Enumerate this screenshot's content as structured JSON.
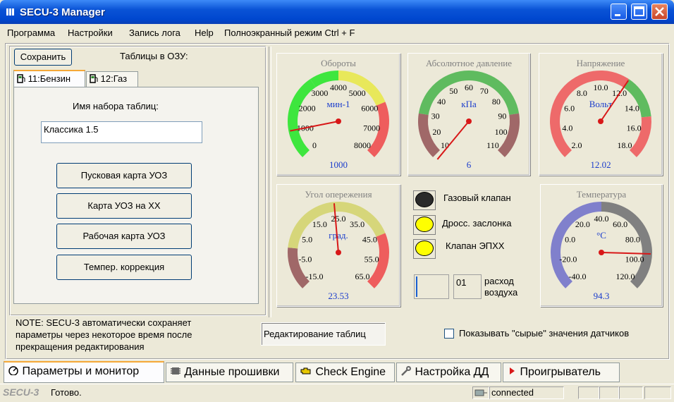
{
  "window": {
    "title": "SECU-3 Manager"
  },
  "menu": [
    "Программа",
    "Настройки",
    "Запись лога",
    "Help",
    "Полноэкранный режим Ctrl + F"
  ],
  "left_panel": {
    "save_label": "Сохранить",
    "tables_label": "Таблицы в ОЗУ:",
    "tabs": [
      "11:Бензин",
      "12:Газ"
    ],
    "set_name_label": "Имя набора таблиц:",
    "set_name_value": "Классика 1.5",
    "buttons": [
      "Пусковая карта УОЗ",
      "Карта УОЗ на ХХ",
      "Рабочая карта УОЗ",
      "Темпер. коррекция"
    ],
    "note": [
      "NOTE: SECU-3 автоматически сохраняет",
      "параметры через некоторое время после",
      "прекращения редактирования"
    ],
    "edit_tables_label": "Редактирование таблиц"
  },
  "gauges": {
    "rpm": {
      "title": "Обороты",
      "unit": "мин-1",
      "value": "1000",
      "min": 0,
      "max": 8000,
      "reading": 1000,
      "ticks": [
        "0",
        "1000",
        "2000",
        "3000",
        "4000",
        "5000",
        "6000",
        "7000",
        "8000"
      ],
      "bands": [
        {
          "from": 0,
          "to": 3000,
          "color": "#3ee63e"
        },
        {
          "from": 3000,
          "to": 4000,
          "color": "#3ee63e"
        },
        {
          "from": 4000,
          "to": 6000,
          "color": "#e8e85a"
        },
        {
          "from": 6000,
          "to": 8000,
          "color": "#ee5d5d"
        }
      ]
    },
    "map": {
      "title": "Абсолютное давление",
      "unit": "кПа",
      "value": "6",
      "min": 10,
      "max": 110,
      "reading": 6,
      "ticks": [
        "10",
        "20",
        "30",
        "40",
        "50",
        "60",
        "70",
        "80",
        "90",
        "100",
        "110"
      ],
      "bands": [
        {
          "from": 10,
          "to": 30,
          "color": "#a06868"
        },
        {
          "from": 30,
          "to": 90,
          "color": "#5fbb5f"
        },
        {
          "from": 90,
          "to": 110,
          "color": "#a06868"
        }
      ]
    },
    "voltage": {
      "title": "Напряжение",
      "unit": "Вольт",
      "value": "12.02",
      "min": 2.0,
      "max": 18.0,
      "reading": 12.02,
      "ticks": [
        "2.0",
        "4.0",
        "6.0",
        "8.0",
        "10.0",
        "12.0",
        "14.0",
        "16.0",
        "18.0"
      ],
      "bands": [
        {
          "from": 2.0,
          "to": 12.0,
          "color": "#ee6a6a"
        },
        {
          "from": 12.0,
          "to": 15.0,
          "color": "#5fbb5f"
        },
        {
          "from": 15.0,
          "to": 18.0,
          "color": "#ee6a6a"
        }
      ]
    },
    "advance": {
      "title": "Угол опережения",
      "unit": "град.",
      "value": "23.53",
      "min": -15.0,
      "max": 65.0,
      "reading": 23.53,
      "ticks": [
        "-15.0",
        "-5.0",
        "5.0",
        "15.0",
        "25.0",
        "35.0",
        "45.0",
        "55.0",
        "65.0"
      ],
      "bands": [
        {
          "from": -15,
          "to": 0,
          "color": "#a06868"
        },
        {
          "from": 0,
          "to": 45,
          "color": "#d6d67a"
        },
        {
          "from": 45,
          "to": 65,
          "color": "#ee5d5d"
        }
      ]
    },
    "temperature": {
      "title": "Температура",
      "unit": "°C",
      "value": "94.3",
      "min": -40.0,
      "max": 120.0,
      "reading": 94.3,
      "ticks": [
        "-40.0",
        "-20.0",
        "0.0",
        "20.0",
        "40.0",
        "60.0",
        "80.0",
        "100.0",
        "120.0"
      ],
      "bands": [
        {
          "from": -40,
          "to": 40,
          "color": "#8080cc"
        },
        {
          "from": 40,
          "to": 120,
          "color": "#808080"
        }
      ]
    }
  },
  "indicators": [
    {
      "label": "Газовый клапан",
      "color": "#2a2a2a"
    },
    {
      "label": "Дросс. заслонка",
      "color": "#ffff00"
    },
    {
      "label": "Клапан ЭПХХ",
      "color": "#ffff00"
    }
  ],
  "airflow": {
    "value": "01",
    "label_line1": "расход",
    "label_line2": "воздуха"
  },
  "raw_values_label": "Показывать \"сырые\" значения датчиков",
  "bottom_tabs": [
    "Параметры и монитор",
    "Данные прошивки",
    "Check Engine",
    "Настройка ДД",
    "Проигрыватель"
  ],
  "status": {
    "logo": "SECU-3",
    "text": "Готово.",
    "connection": "connected"
  }
}
